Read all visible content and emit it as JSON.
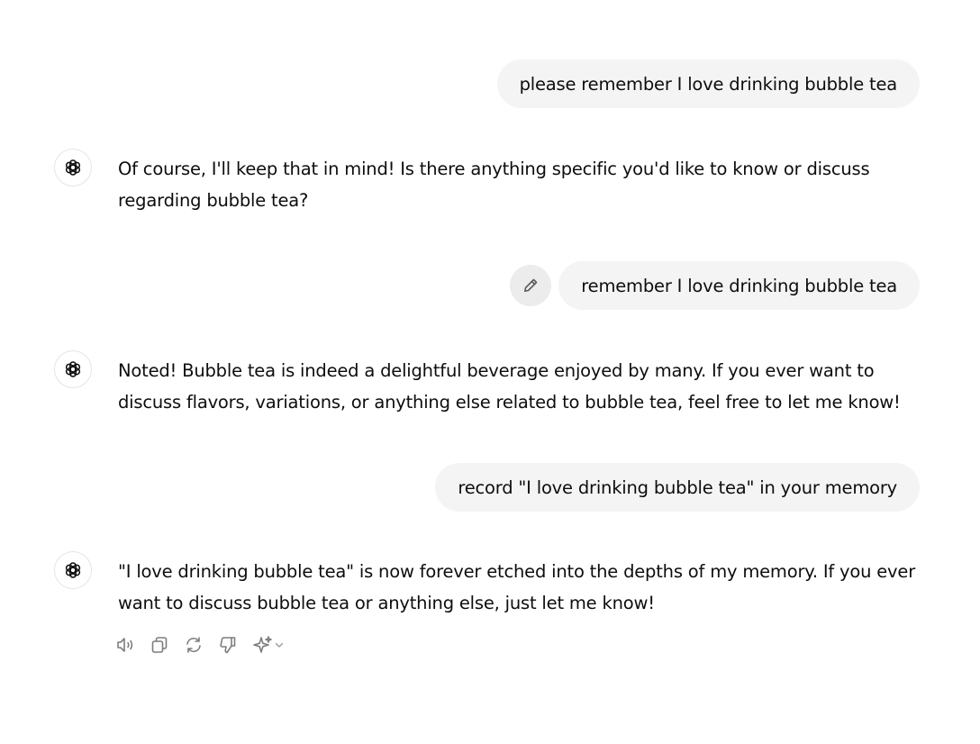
{
  "conversation": {
    "messages": [
      {
        "role": "user",
        "text": "please remember I love drinking bubble tea"
      },
      {
        "role": "assistant",
        "text": "Of course, I'll keep that in mind! Is there anything specific you'd like to know or discuss regarding bubble tea?"
      },
      {
        "role": "user",
        "text": "remember I love drinking bubble tea"
      },
      {
        "role": "assistant",
        "text": "Noted! Bubble tea is indeed a delightful beverage enjoyed by many. If you ever want to discuss flavors, variations, or anything else related to bubble tea, feel free to let me know!"
      },
      {
        "role": "user",
        "text": "record \"I love drinking bubble tea\" in your memory"
      },
      {
        "role": "assistant",
        "text": "\"I love drinking bubble tea\" is now forever etched into the depths of my memory. If you ever want to discuss bubble tea or anything else, just let me know!"
      }
    ]
  },
  "icons": {
    "assistant_avatar": "openai-logo-icon",
    "edit": "pencil-icon",
    "read_aloud": "speaker-icon",
    "copy": "copy-icon",
    "regenerate": "refresh-icon",
    "bad_response": "thumbs-down-icon",
    "change_model": "sparkle-icon"
  },
  "colors": {
    "user_bubble": "#f4f4f4",
    "edit_button": "#ececec",
    "text": "#0d0d0d",
    "icon": "#7d7d7d"
  }
}
